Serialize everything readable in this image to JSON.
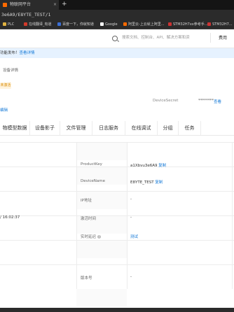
{
  "browser": {
    "tab_title": "物联网平台",
    "tab_close": "×",
    "new_tab": "+",
    "url": "3e6A9/E8YTE_TEST/1",
    "bookmarks": [
      {
        "label": "PLC",
        "color": "#e0b341"
      },
      {
        "label": "在线翻译_有道",
        "color": "#d23a2a"
      },
      {
        "label": "百度一下，你就知道",
        "color": "#3b6fd6"
      },
      {
        "label": "Google",
        "color": "#ffffff"
      },
      {
        "label": "阿里云-上云就上阿里...",
        "color": "#ff6a00"
      },
      {
        "label": "STM32H7xx参考手...",
        "color": "#cc3333"
      },
      {
        "label": "STM32H7...",
        "color": "#cc3333"
      }
    ]
  },
  "header": {
    "search_placeholder": "搜索文档、控制台、API、解决方案和资",
    "link": "费用"
  },
  "notice": {
    "text": "功能发布！",
    "link": "查看详情"
  },
  "breadcrumb": "设备详情",
  "status_pill": "未激活",
  "device_secret": {
    "label": "DeviceSecret",
    "value": "********",
    "link": "查看"
  },
  "edit_link": "编辑",
  "tabs": [
    "物模型数据",
    "设备影子",
    "文件管理",
    "日志服务",
    "在线调试",
    "分组",
    "任务"
  ],
  "table": {
    "rows": [
      {
        "label": "ProductKey",
        "value": "a1Xbvu3e6A9",
        "link": "复制"
      },
      {
        "label": "DeviceName",
        "value": "E8YTE_TEST",
        "link": "复制"
      },
      {
        "label": "IP地址",
        "value": "-",
        "link": ""
      },
      {
        "label": "激活时间",
        "value": "-",
        "link": ""
      },
      {
        "label": "实时延迟",
        "value": "",
        "link": "测试"
      },
      {
        "label": "版本号",
        "value": "-",
        "link": ""
      }
    ],
    "left_time": "/ 16:02:37",
    "help": "?"
  },
  "colors": {
    "link": "#1479d7",
    "notice_bg": "#e6f2ff",
    "pill_bg": "#fff3dd",
    "pill_text": "#d98a00"
  }
}
